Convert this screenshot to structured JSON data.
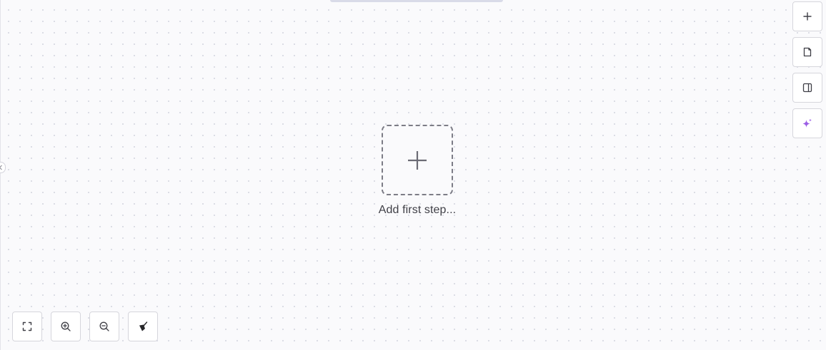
{
  "canvas": {
    "add_first_step_label": "Add first step...",
    "add_node_icon": "plus-icon"
  },
  "right_toolbar": {
    "buttons": [
      {
        "name": "add",
        "icon": "plus-icon"
      },
      {
        "name": "notes",
        "icon": "sticky-note-icon"
      },
      {
        "name": "toggle-panel",
        "icon": "panel-right-icon"
      },
      {
        "name": "ai-assistant",
        "icon": "sparkles-icon",
        "color": "#9b5de5"
      }
    ]
  },
  "bottom_toolbar": {
    "buttons": [
      {
        "name": "fit-view",
        "icon": "fit-screen-icon"
      },
      {
        "name": "zoom-in",
        "icon": "zoom-in-icon"
      },
      {
        "name": "zoom-out",
        "icon": "zoom-out-icon"
      },
      {
        "name": "clean-up",
        "icon": "broom-icon"
      }
    ]
  },
  "colors": {
    "background": "#fafafc",
    "accent": "#9b5de5",
    "border": "#d6d6dc",
    "icon": "#52525b"
  }
}
